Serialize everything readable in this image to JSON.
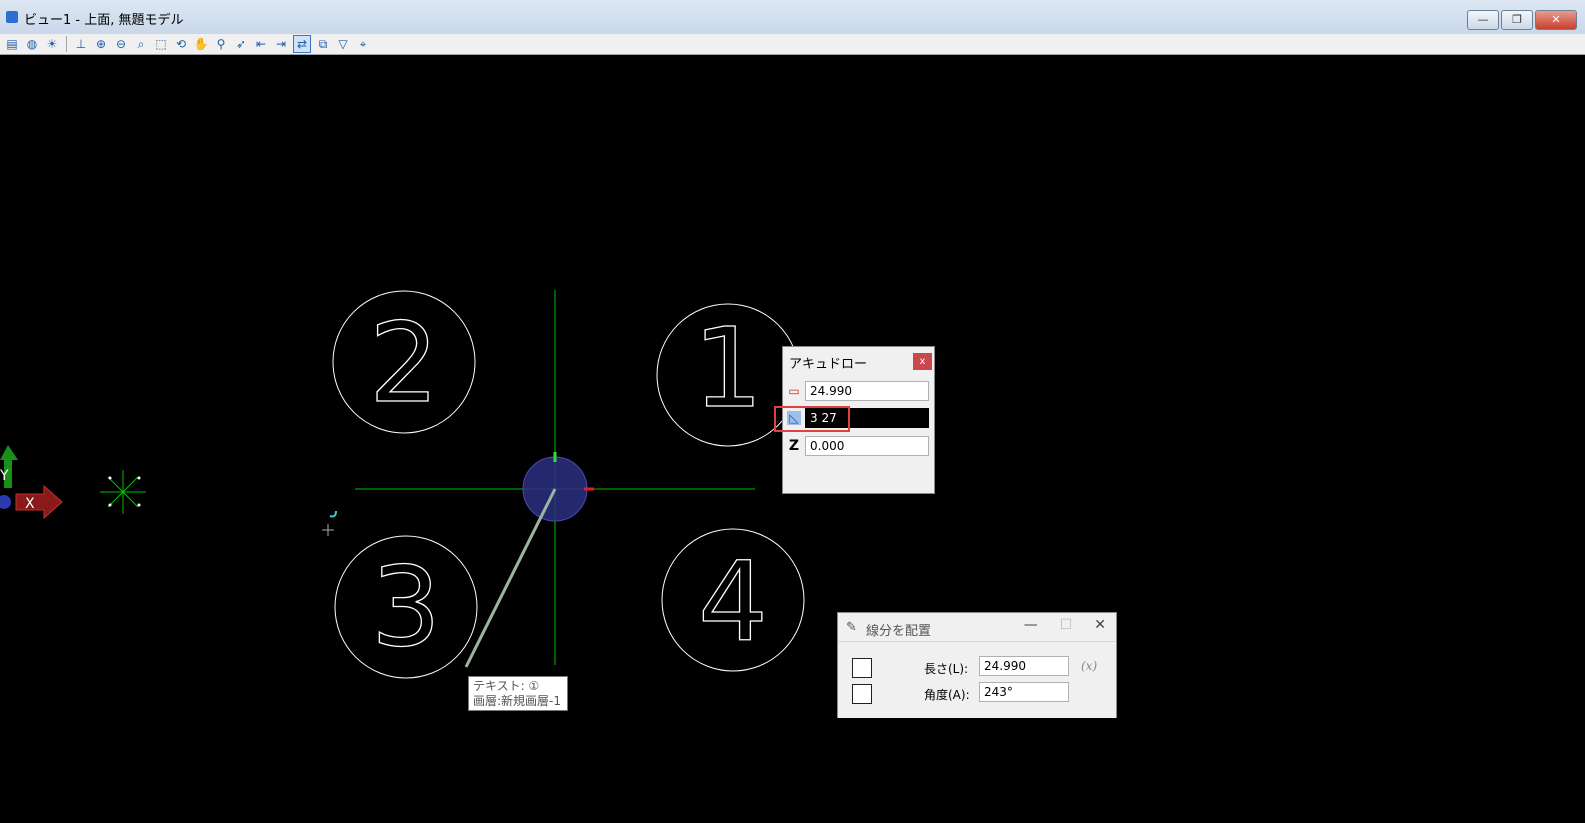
{
  "window": {
    "title": "ビュー1 - 上面, 無題モデル"
  },
  "window_buttons": {
    "minimize": "—",
    "restore": "❐",
    "close": "✕"
  },
  "toolbar_icons": [
    "view-attributes-icon",
    "display-style-icon",
    "lighting-icon",
    "update-view-icon",
    "zoom-in-icon",
    "zoom-out-icon",
    "window-area-icon",
    "fit-view-icon",
    "rotate-view-icon",
    "pan-view-icon",
    "walk-icon",
    "fly-icon",
    "view-previous-icon",
    "view-next-icon",
    "view-toggle-icon",
    "clip-volume-icon",
    "clip-mask-icon",
    "camera-icon"
  ],
  "canvas": {
    "circle_labels": [
      "1",
      "2",
      "3",
      "4"
    ],
    "axis_triad": {
      "x_label": "X",
      "y_label": "Y"
    }
  },
  "accudraw": {
    "title": "アキュドロー",
    "close_label": "x",
    "distance": "24.990",
    "angle": "3 27",
    "z_label": "Z",
    "z": "0.000"
  },
  "tooltip": {
    "line1": "テキスト: ①",
    "line2": "画層:新規画層-1"
  },
  "place_line": {
    "title": "線分を配置",
    "length_label": "長さ(L):",
    "length_value": "24.990",
    "angle_label": "角度(A):",
    "angle_value": "243°",
    "fx_label": "(x)",
    "min_label": "—",
    "max_label": "☐",
    "close_label": "✕"
  },
  "colors": {
    "background": "#000000",
    "crosshair": "#00c000",
    "circles": "#ffffff",
    "drag_line": "#9fb4a0",
    "accudraw_compass": "#3a3aa0"
  }
}
